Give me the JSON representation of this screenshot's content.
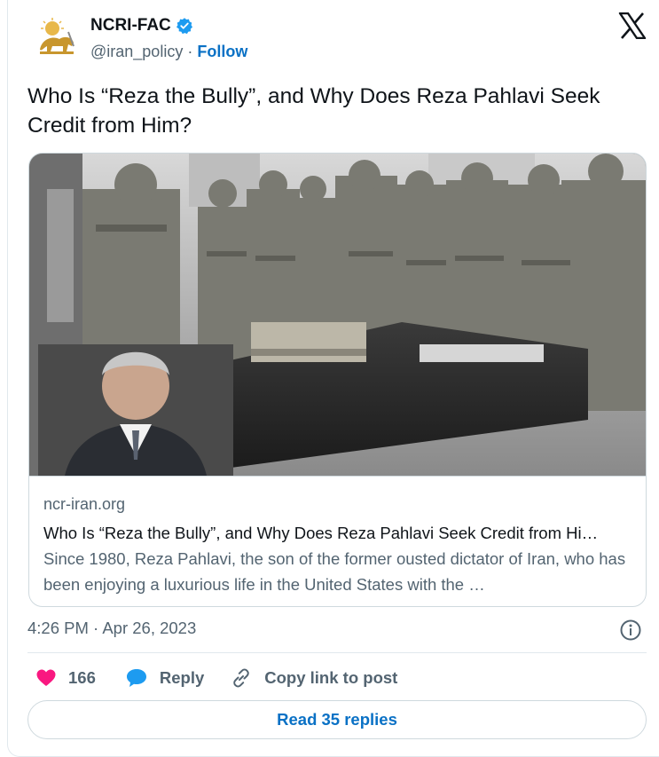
{
  "account": {
    "name": "NCRI-FAC",
    "handle": "@iran_policy",
    "separator": "·",
    "follow_label": "Follow"
  },
  "tweet": {
    "text": "Who Is “Reza the Bully”, and Why Does Reza Pahlavi Seek Credit from Him?"
  },
  "link_card": {
    "domain": "ncr-iran.org",
    "title": "Who Is “Reza the Bully”, and Why Does Reza Pahlavi Seek Credit from Hi…",
    "description": "Since 1980, Reza Pahlavi, the son of the former ousted dictator of Iran, who has been enjoying a luxurious life in the United States with the …"
  },
  "meta": {
    "timestamp": "4:26 PM · Apr 26, 2023"
  },
  "actions": {
    "like_count": "166",
    "reply_label": "Reply",
    "copy_label": "Copy link to post"
  },
  "footer": {
    "read_replies_label": "Read 35 replies"
  },
  "icons": {
    "verified": "verified-badge-icon",
    "x_logo": "x-logo-icon",
    "info": "info-icon",
    "like": "heart-icon",
    "reply": "speech-bubble-icon",
    "copy": "link-icon"
  },
  "colors": {
    "accent": "#0a71c5",
    "like": "#f91880",
    "reply": "#1d9bf0",
    "verified": "#1d9bf0"
  }
}
